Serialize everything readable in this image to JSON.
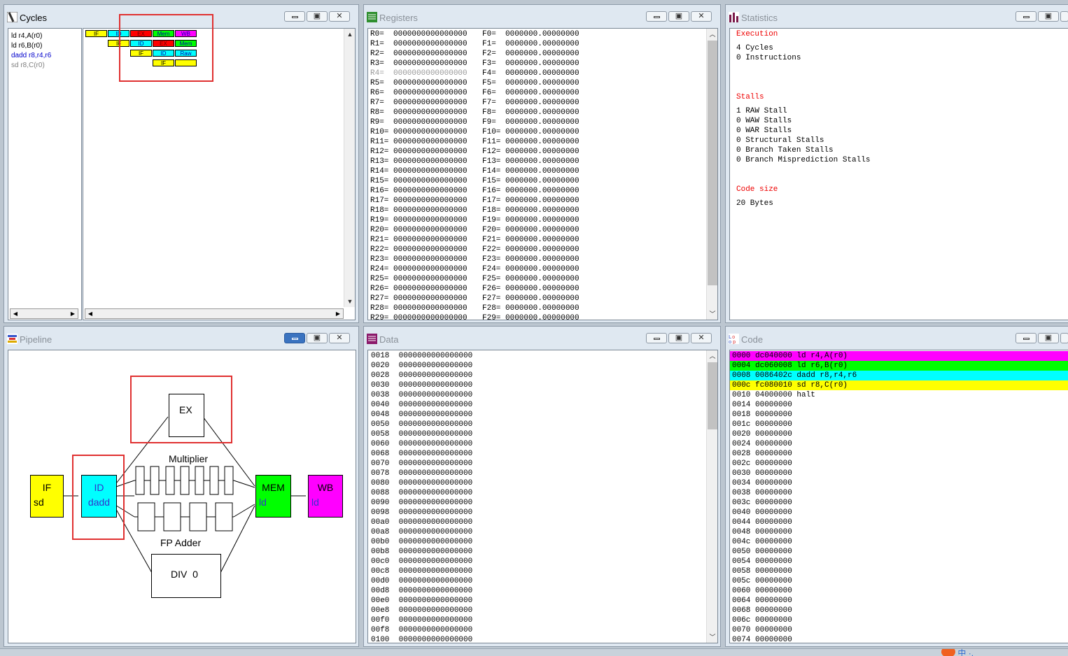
{
  "colors": {
    "if": "#ffff00",
    "id": "#00ffff",
    "ex": "#ff0000",
    "mem": "#00ff00",
    "wb": "#ff00ff",
    "highlight_box": "#e03030",
    "inactive_text": "#8a9199",
    "stat_heading": "#ee0000"
  },
  "windows": {
    "cycles": {
      "title": "Cycles"
    },
    "registers": {
      "title": "Registers"
    },
    "statistics": {
      "title": "Statistics"
    },
    "pipeline": {
      "title": "Pipeline"
    },
    "data": {
      "title": "Data"
    },
    "code": {
      "title": "Code"
    }
  },
  "titlebar_buttons": {
    "minimize": "minimize",
    "maximize": "▣",
    "close": "✕"
  },
  "cycles": {
    "instructions": [
      {
        "text": "ld r4,A(r0)",
        "color": "#000000"
      },
      {
        "text": "ld r6,B(r0)",
        "color": "#000000"
      },
      {
        "text": "dadd r8,r4,r6",
        "color": "#0000cc"
      },
      {
        "text": "sd r8,C(r0)",
        "color": "#808080"
      }
    ],
    "rows": [
      [
        {
          "t": "IF",
          "c": "if"
        },
        {
          "t": "ID",
          "c": "id"
        },
        {
          "t": "EX",
          "c": "ex"
        },
        {
          "t": "Mem",
          "c": "mem"
        },
        {
          "t": "WB",
          "c": "wb"
        }
      ],
      [
        {
          "t": "IF",
          "c": "if"
        },
        {
          "t": "ID",
          "c": "id"
        },
        {
          "t": "EX",
          "c": "ex"
        },
        {
          "t": "Mem",
          "c": "mem"
        }
      ],
      [
        {
          "t": "IF",
          "c": "if"
        },
        {
          "t": "ID",
          "c": "id"
        },
        {
          "t": "Raw",
          "c": "id"
        }
      ],
      [
        {
          "t": "IF",
          "c": "if"
        },
        {
          "t": "",
          "c": "if"
        }
      ]
    ]
  },
  "registers": {
    "rows": [
      {
        "r": "R0=  0000000000000000",
        "f": "F0=  0000000.00000000"
      },
      {
        "r": "R1=  0000000000000000",
        "f": "F1=  0000000.00000000"
      },
      {
        "r": "R2=  0000000000000000",
        "f": "F2=  0000000.00000000"
      },
      {
        "r": "R3=  0000000000000000",
        "f": "F3=  0000000.00000000"
      },
      {
        "r": "R4=  0000000000000000",
        "f": "F4=  0000000.00000000",
        "dim": true
      },
      {
        "r": "R5=  0000000000000000",
        "f": "F5=  0000000.00000000"
      },
      {
        "r": "R6=  0000000000000000",
        "f": "F6=  0000000.00000000"
      },
      {
        "r": "R7=  0000000000000000",
        "f": "F7=  0000000.00000000"
      },
      {
        "r": "R8=  0000000000000000",
        "f": "F8=  0000000.00000000"
      },
      {
        "r": "R9=  0000000000000000",
        "f": "F9=  0000000.00000000"
      },
      {
        "r": "R10= 0000000000000000",
        "f": "F10= 0000000.00000000"
      },
      {
        "r": "R11= 0000000000000000",
        "f": "F11= 0000000.00000000"
      },
      {
        "r": "R12= 0000000000000000",
        "f": "F12= 0000000.00000000"
      },
      {
        "r": "R13= 0000000000000000",
        "f": "F13= 0000000.00000000"
      },
      {
        "r": "R14= 0000000000000000",
        "f": "F14= 0000000.00000000"
      },
      {
        "r": "R15= 0000000000000000",
        "f": "F15= 0000000.00000000"
      },
      {
        "r": "R16= 0000000000000000",
        "f": "F16= 0000000.00000000"
      },
      {
        "r": "R17= 0000000000000000",
        "f": "F17= 0000000.00000000"
      },
      {
        "r": "R18= 0000000000000000",
        "f": "F18= 0000000.00000000"
      },
      {
        "r": "R19= 0000000000000000",
        "f": "F19= 0000000.00000000"
      },
      {
        "r": "R20= 0000000000000000",
        "f": "F20= 0000000.00000000"
      },
      {
        "r": "R21= 0000000000000000",
        "f": "F21= 0000000.00000000"
      },
      {
        "r": "R22= 0000000000000000",
        "f": "F22= 0000000.00000000"
      },
      {
        "r": "R23= 0000000000000000",
        "f": "F23= 0000000.00000000"
      },
      {
        "r": "R24= 0000000000000000",
        "f": "F24= 0000000.00000000"
      },
      {
        "r": "R25= 0000000000000000",
        "f": "F25= 0000000.00000000"
      },
      {
        "r": "R26= 0000000000000000",
        "f": "F26= 0000000.00000000"
      },
      {
        "r": "R27= 0000000000000000",
        "f": "F27= 0000000.00000000"
      },
      {
        "r": "R28= 0000000000000000",
        "f": "F28= 0000000.00000000"
      },
      {
        "r": "R29= 0000000000000000",
        "f": "F29= 0000000.00000000"
      }
    ]
  },
  "statistics": {
    "execution_heading": "Execution",
    "cycles": "4 Cycles",
    "instructions": "0 Instructions",
    "stalls_heading": "Stalls",
    "stalls": [
      "1 RAW Stall",
      "0 WAW Stalls",
      "0 WAR Stalls",
      "0 Structural Stalls",
      "0 Branch Taken Stalls",
      "0 Branch Misprediction Stalls"
    ],
    "codesize_heading": "Code size",
    "codesize": "20 Bytes"
  },
  "pipeline": {
    "if": {
      "name": "IF",
      "instr": "sd"
    },
    "id": {
      "name": "ID",
      "instr": "dadd"
    },
    "ex": {
      "name": "EX"
    },
    "mem": {
      "name": "MEM",
      "instr": "ld"
    },
    "wb": {
      "name": "WB",
      "instr": "ld"
    },
    "multiplier_label": "Multiplier",
    "fp_adder_label": "FP Adder",
    "div_label": "DIV  0"
  },
  "data": {
    "rows": [
      "0018  0000000000000000",
      "0020  0000000000000000",
      "0028  0000000000000000",
      "0030  0000000000000000",
      "0038  0000000000000000",
      "0040  0000000000000000",
      "0048  0000000000000000",
      "0050  0000000000000000",
      "0058  0000000000000000",
      "0060  0000000000000000",
      "0068  0000000000000000",
      "0070  0000000000000000",
      "0078  0000000000000000",
      "0080  0000000000000000",
      "0088  0000000000000000",
      "0090  0000000000000000",
      "0098  0000000000000000",
      "00a0  0000000000000000",
      "00a8  0000000000000000",
      "00b0  0000000000000000",
      "00b8  0000000000000000",
      "00c0  0000000000000000",
      "00c8  0000000000000000",
      "00d0  0000000000000000",
      "00d8  0000000000000000",
      "00e0  0000000000000000",
      "00e8  0000000000000000",
      "00f0  0000000000000000",
      "00f8  0000000000000000",
      "0100  0000000000000000"
    ]
  },
  "code": {
    "rows": [
      {
        "text": "0000 dc040000 ld r4,A(r0)",
        "bg": "#ff00ff"
      },
      {
        "text": "0004 dc060008 ld r6,B(r0)",
        "bg": "#00ff00"
      },
      {
        "text": "0008 0086402c dadd r8,r4,r6",
        "bg": "#00ffff"
      },
      {
        "text": "000c fc080010 sd r8,C(r0)",
        "bg": "#ffff00"
      },
      {
        "text": "0010 04000000 halt",
        "bg": ""
      },
      {
        "text": "0014 00000000",
        "bg": ""
      },
      {
        "text": "0018 00000000",
        "bg": ""
      },
      {
        "text": "001c 00000000",
        "bg": ""
      },
      {
        "text": "0020 00000000",
        "bg": ""
      },
      {
        "text": "0024 00000000",
        "bg": ""
      },
      {
        "text": "0028 00000000",
        "bg": ""
      },
      {
        "text": "002c 00000000",
        "bg": ""
      },
      {
        "text": "0030 00000000",
        "bg": ""
      },
      {
        "text": "0034 00000000",
        "bg": ""
      },
      {
        "text": "0038 00000000",
        "bg": ""
      },
      {
        "text": "003c 00000000",
        "bg": ""
      },
      {
        "text": "0040 00000000",
        "bg": ""
      },
      {
        "text": "0044 00000000",
        "bg": ""
      },
      {
        "text": "0048 00000000",
        "bg": ""
      },
      {
        "text": "004c 00000000",
        "bg": ""
      },
      {
        "text": "0050 00000000",
        "bg": ""
      },
      {
        "text": "0054 00000000",
        "bg": ""
      },
      {
        "text": "0058 00000000",
        "bg": ""
      },
      {
        "text": "005c 00000000",
        "bg": ""
      },
      {
        "text": "0060 00000000",
        "bg": ""
      },
      {
        "text": "0064 00000000",
        "bg": ""
      },
      {
        "text": "0068 00000000",
        "bg": ""
      },
      {
        "text": "006c 00000000",
        "bg": ""
      },
      {
        "text": "0070 00000000",
        "bg": ""
      },
      {
        "text": "0074 00000000",
        "bg": ""
      }
    ]
  },
  "taskbar": {
    "ime_chars": [
      "中",
      "·,"
    ]
  }
}
